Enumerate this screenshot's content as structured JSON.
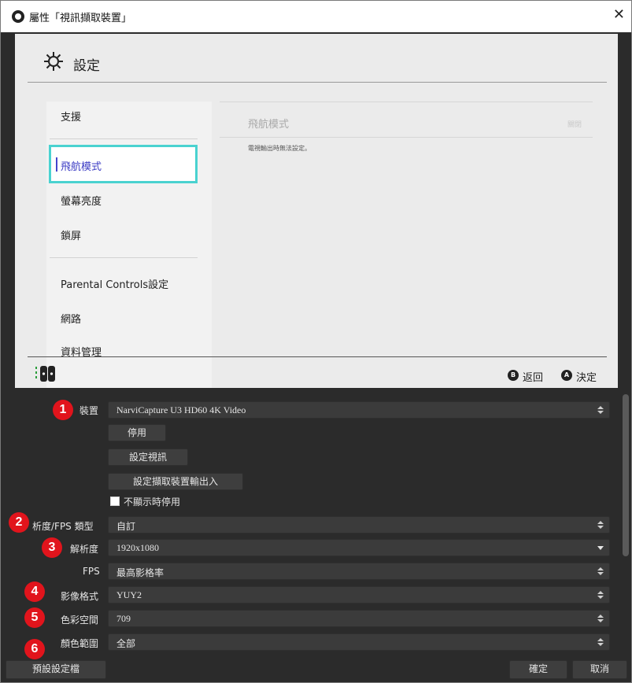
{
  "window": {
    "title": "屬性「視訊擷取裝置」",
    "close_glyph": "✕"
  },
  "preview": {
    "settings_title": "設定",
    "menu": [
      {
        "label": "支援"
      },
      {
        "label": "飛航模式",
        "selected": true
      },
      {
        "label": "螢幕亮度"
      },
      {
        "label": "鎖屏"
      },
      {
        "label": "Parental Controls設定"
      },
      {
        "label": "網路"
      },
      {
        "label": "資料管理"
      }
    ],
    "content_title": "飛航模式",
    "content_right": "關閉",
    "content_note": "電視輸出時無法設定。",
    "footer": {
      "back_glyph": "B",
      "back_label": "返回",
      "ok_glyph": "A",
      "ok_label": "決定"
    }
  },
  "form": {
    "device_label": "裝置",
    "device_value": "NarviCapture U3 HD60 4K Video",
    "deactivate_button": "停用",
    "configure_video_button": "設定視訊",
    "configure_crossbar_button": "設定擷取裝置輸出入",
    "deactivate_when_hidden_label": "不顯示時停用",
    "deactivate_when_hidden_checked": false,
    "res_fps_type_label": "析度/FPS 類型",
    "res_fps_type_value": "自訂",
    "resolution_label": "解析度",
    "resolution_value": "1920x1080",
    "fps_label": "FPS",
    "fps_value": "最高影格率",
    "video_format_label": "影像格式",
    "video_format_value": "YUY2",
    "color_space_label": "色彩空間",
    "color_space_value": "709",
    "color_range_label": "顏色範圍",
    "color_range_value": "全部"
  },
  "markers": [
    "1",
    "2",
    "3",
    "4",
    "5",
    "6"
  ],
  "bottom": {
    "defaults_button": "預設設定檔",
    "ok_button": "確定",
    "cancel_button": "取消"
  },
  "colors": {
    "marker_red": "#e1141c",
    "selection_cyan": "#4ad2d0",
    "selected_text": "#3b3bc4",
    "dark_bg": "#2b2b2b"
  }
}
